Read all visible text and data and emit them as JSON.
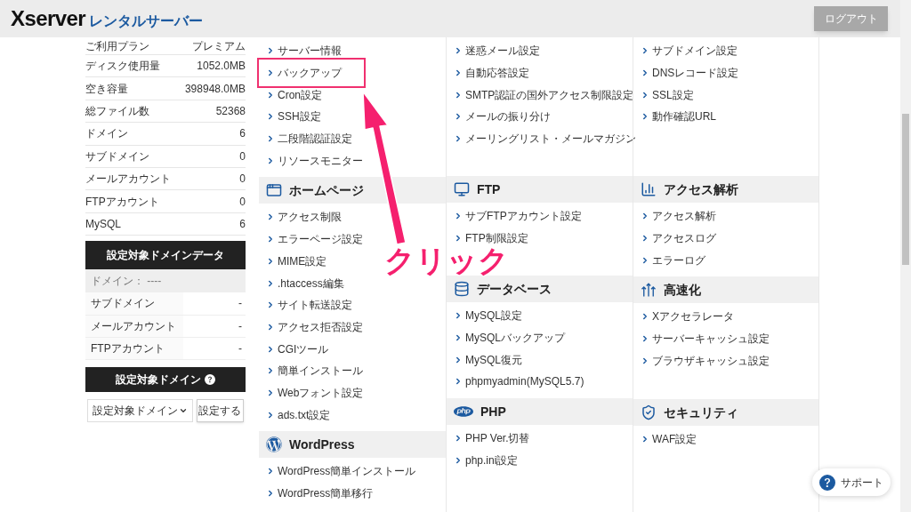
{
  "header": {
    "logo": {
      "brand": "Xserver",
      "product": "レンタルサーバー"
    },
    "logout_button": "ログアウト"
  },
  "account_summary": [
    {
      "label": "ご利用プラン",
      "value": "プレミアム"
    },
    {
      "label": "ディスク使用量",
      "value": "1052.0MB"
    },
    {
      "label": "空き容量",
      "value": "398948.0MB"
    },
    {
      "label": "総ファイル数",
      "value": "52368"
    },
    {
      "label": "ドメイン",
      "value": "6"
    },
    {
      "label": "サブドメイン",
      "value": "0"
    },
    {
      "label": "メールアカウント",
      "value": "0"
    },
    {
      "label": "FTPアカウント",
      "value": "0"
    },
    {
      "label": "MySQL",
      "value": "6"
    }
  ],
  "domain_data": {
    "title": "設定対象ドメインデータ",
    "domain": "ドメイン： ----",
    "rows": [
      {
        "label": "サブドメイン",
        "value": "-"
      },
      {
        "label": "メールアカウント",
        "value": "-"
      },
      {
        "label": "FTPアカウント",
        "value": "-"
      }
    ]
  },
  "domain_selector": {
    "title": "設定対象ドメイン",
    "select_value": "設定対象ドメイン",
    "button": "設定する"
  },
  "menu_columns": [
    [
      {
        "items": [
          {
            "label": "サーバー情報",
            "highlighted": false
          },
          {
            "label": "バックアップ",
            "highlighted": true
          },
          {
            "label": "Cron設定",
            "highlighted": false
          },
          {
            "label": "SSH設定",
            "highlighted": false
          },
          {
            "label": "二段階認証設定",
            "highlighted": false
          },
          {
            "label": "リソースモニター",
            "highlighted": false
          }
        ]
      },
      {
        "title": "ホームページ",
        "items": [
          {
            "label": "アクセス制限"
          },
          {
            "label": "エラーページ設定"
          },
          {
            "label": "MIME設定"
          },
          {
            "label": ".htaccess編集"
          },
          {
            "label": "サイト転送設定"
          },
          {
            "label": "アクセス拒否設定"
          },
          {
            "label": "CGIツール"
          },
          {
            "label": "簡単インストール"
          },
          {
            "label": "Webフォント設定"
          },
          {
            "label": "ads.txt設定"
          }
        ]
      },
      {
        "title": "WordPress",
        "items": [
          {
            "label": "WordPress簡単インストール"
          },
          {
            "label": "WordPress簡単移行"
          }
        ]
      }
    ],
    [
      {
        "items": [
          {
            "label": "迷惑メール設定"
          },
          {
            "label": "自動応答設定"
          },
          {
            "label": "SMTP認証の国外アクセス制限設定"
          },
          {
            "label": "メールの振り分け"
          },
          {
            "label": "メーリングリスト・メールマガジン"
          }
        ]
      },
      {
        "title": "FTP",
        "items": [
          {
            "label": "サブFTPアカウント設定"
          },
          {
            "label": "FTP制限設定"
          }
        ]
      },
      {
        "title": "データベース",
        "items": [
          {
            "label": "MySQL設定"
          },
          {
            "label": "MySQLバックアップ"
          },
          {
            "label": "MySQL復元"
          },
          {
            "label": "phpmyadmin(MySQL5.7)"
          }
        ]
      },
      {
        "title": "PHP",
        "items": [
          {
            "label": "PHP Ver.切替"
          },
          {
            "label": "php.ini設定"
          }
        ]
      }
    ],
    [
      {
        "items": [
          {
            "label": "サブドメイン設定"
          },
          {
            "label": "DNSレコード設定"
          },
          {
            "label": "SSL設定"
          },
          {
            "label": "動作確認URL"
          }
        ]
      },
      {
        "title": "アクセス解析",
        "items": [
          {
            "label": "アクセス解析"
          },
          {
            "label": "アクセスログ"
          },
          {
            "label": "エラーログ"
          }
        ]
      },
      {
        "title": "高速化",
        "items": [
          {
            "label": "Xアクセラレータ"
          },
          {
            "label": "サーバーキャッシュ設定"
          },
          {
            "label": "ブラウザキャッシュ設定"
          }
        ]
      },
      {
        "title": "セキュリティ",
        "items": [
          {
            "label": "WAF設定"
          }
        ]
      }
    ]
  ],
  "support_button": "サポート",
  "annotation": {
    "label": "クリック"
  }
}
